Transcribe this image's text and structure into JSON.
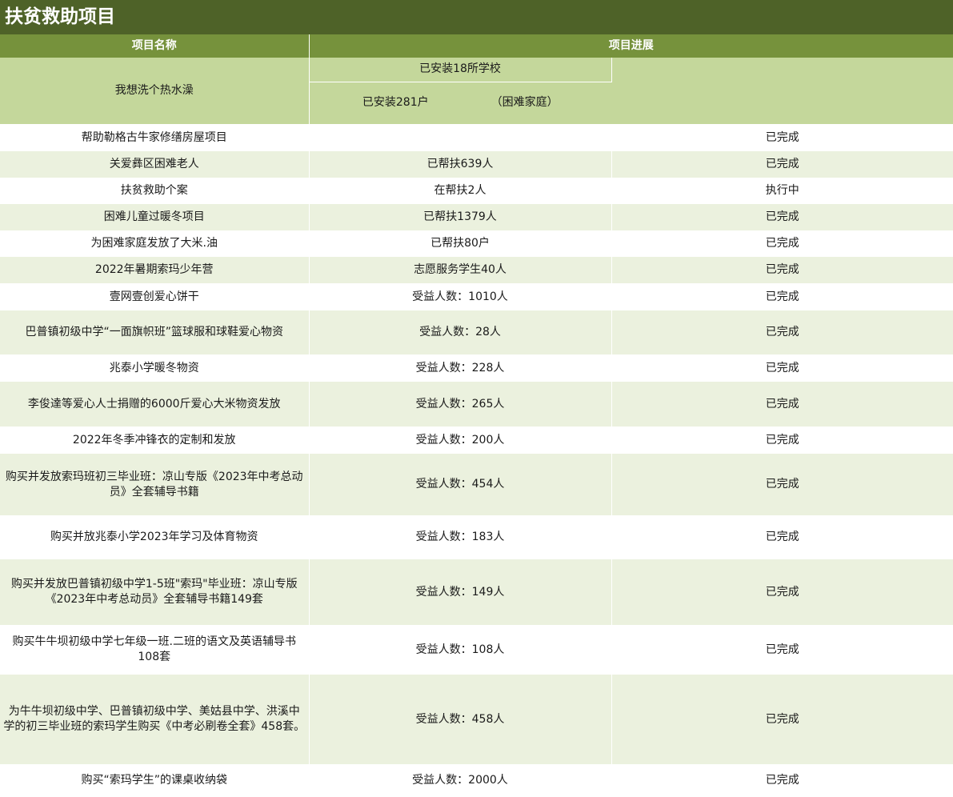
{
  "title": "扶贫救助项目",
  "headers": {
    "name": "项目名称",
    "progress": "项目进展"
  },
  "special": {
    "name": "我想洗个热水澡",
    "progress1": "已安装18所学校",
    "progress2a": "已安装281户",
    "progress2b": "（困难家庭）"
  },
  "rows": [
    {
      "name": "帮助勒格古牛家修缮房屋项目",
      "progress": "",
      "status": "已完成"
    },
    {
      "name": "关爱彝区困难老人",
      "progress": "已帮扶639人",
      "status": "已完成"
    },
    {
      "name": "扶贫救助个案",
      "progress": "在帮扶2人",
      "status": "执行中"
    },
    {
      "name": "困难儿童过暖冬项目",
      "progress": "已帮扶1379人",
      "status": "已完成"
    },
    {
      "name": "为困难家庭发放了大米.油",
      "progress": "已帮扶80户",
      "status": "已完成"
    },
    {
      "name": "2022年暑期索玛少年营",
      "progress": "志愿服务学生40人",
      "status": "已完成"
    },
    {
      "name": "壹网壹创爱心饼干",
      "progress": "受益人数：1010人",
      "status": "已完成"
    },
    {
      "name": "巴普镇初级中学“一面旗帜班”篮球服和球鞋爱心物资",
      "progress": "受益人数：28人",
      "status": "已完成"
    },
    {
      "name": "兆泰小学暖冬物资",
      "progress": "受益人数：228人",
      "status": "已完成"
    },
    {
      "name": "李俊達等爱心人士捐赠的6000斤爱心大米物资发放",
      "progress": "受益人数：265人",
      "status": "已完成"
    },
    {
      "name": "2022年冬季冲锋衣的定制和发放",
      "progress": "受益人数：200人",
      "status": "已完成"
    },
    {
      "name": "购买并发放索玛班初三毕业班：凉山专版《2023年中考总动员》全套辅导书籍",
      "progress": "受益人数：454人",
      "status": "已完成"
    },
    {
      "name": "购买并放兆泰小学2023年学习及体育物资",
      "progress": "受益人数：183人",
      "status": "已完成"
    },
    {
      "name": "购买并发放巴普镇初级中学1-5班\"索玛\"毕业班：凉山专版《2023年中考总动员》全套辅导书籍149套",
      "progress": "受益人数：149人",
      "status": "已完成"
    },
    {
      "name": "购买牛牛坝初级中学七年级一班.二班的语文及英语辅导书108套",
      "progress": "受益人数：108人",
      "status": "已完成"
    },
    {
      "name": "为牛牛坝初级中学、巴普镇初级中学、美姑县中学、洪溪中学的初三毕业班的索玛学生购买《中考必刷卷全套》458套。",
      "progress": "受益人数：458人",
      "status": "已完成"
    },
    {
      "name": "购买“索玛学生”的课桌收纳袋",
      "progress": "受益人数：2000人",
      "status": "已完成"
    }
  ]
}
